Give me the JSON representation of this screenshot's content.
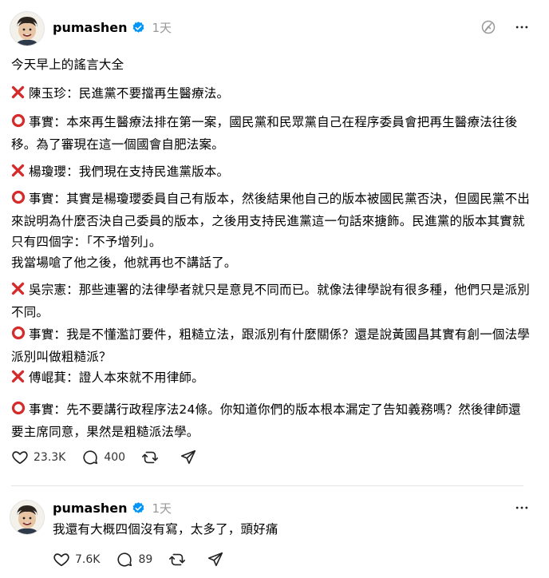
{
  "posts": [
    {
      "username": "pumashen",
      "time": "1天",
      "paragraphs": [
        {
          "mark": "",
          "text": "今天早上的謠言大全"
        },
        {
          "mark": "cross",
          "text": "陳玉珍：民進黨不要擋再生醫療法。"
        },
        {
          "mark": "circle",
          "text": "事實：本來再生醫療法排在第一案，國民黨和民眾黨自己在程序委員會把再生醫療法往後移。為了審現在這一個國會自肥法案。"
        },
        {
          "mark": "cross",
          "text": "楊瓊瓔：我們現在支持民進黨版本。"
        },
        {
          "mark": "circle",
          "text": "事實：其實是楊瓊瓔委員自己有版本，然後結果他自己的版本被國民黨否決，但國民黨不出來說明為什麼否決自己委員的版本，之後用支持民進黨這一句話來搪飾。民進黨的版本其實就只有四個字：「不予增列」。"
        },
        {
          "mark": "",
          "text": "我當場嗆了他之後，他就再也不講話了。"
        },
        {
          "mark": "cross",
          "text": "吳宗憲：那些連署的法律學者就只是意見不同而已。就像法律學說有很多種，他們只是派別不同。"
        },
        {
          "mark": "circle",
          "text": "事實：我是不懂濫訂要件，粗糙立法，跟派別有什麼關係？還是說黃國昌其實有創一個法學派別叫做粗糙派？"
        },
        {
          "mark": "cross",
          "text": "傅崐萁：證人本來就不用律師。"
        },
        {
          "mark": "circle",
          "text": "事實：先不要講行政程序法24條。你知道你們的版本根本漏定了告知義務嗎？然後律師還要主席同意，果然是粗糙派法學。"
        }
      ],
      "likes": "23.3K",
      "replies": "400"
    },
    {
      "username": "pumashen",
      "time": "1天",
      "paragraphs": [
        {
          "mark": "",
          "text": "我還有大概四個沒有寫，太多了，頭好痛"
        }
      ],
      "likes": "7.6K",
      "replies": "89"
    }
  ],
  "colors": {
    "verified": "#0095F6",
    "cross": "#D62B2B",
    "circle": "#D62B2B",
    "muted": "#999999"
  },
  "icons": [
    "verified-badge-icon",
    "mute-icon",
    "more-icon",
    "heart-icon",
    "reply-icon",
    "repost-icon",
    "share-icon",
    "cross-mark-icon",
    "circle-mark-icon"
  ]
}
